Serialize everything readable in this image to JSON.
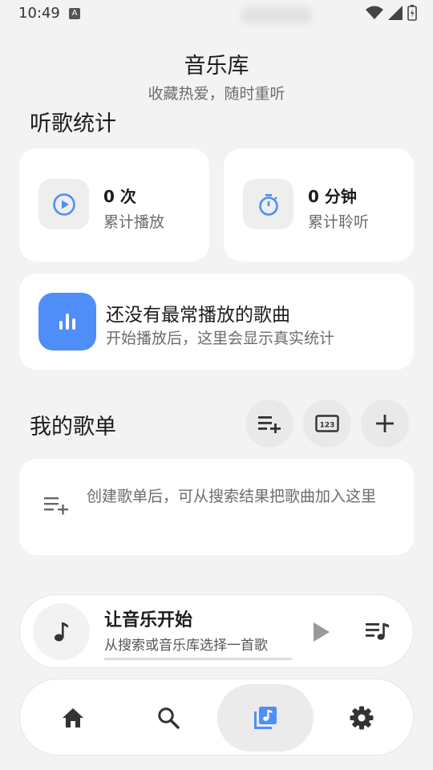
{
  "status": {
    "time": "10:49",
    "badge": "A"
  },
  "header": {
    "title": "音乐库",
    "subtitle": "收藏热爱，随时重听"
  },
  "stats": {
    "section_title": "听歌统计",
    "plays": {
      "value": "0 次",
      "label": "累计播放"
    },
    "duration": {
      "value": "0 分钟",
      "label": "累计聆听"
    }
  },
  "top_song": {
    "title": "还没有最常播放的歌曲",
    "subtitle": "开始播放后，这里会显示真实统计"
  },
  "playlists": {
    "section_title": "我的歌单",
    "empty_text": "创建歌单后，可从搜索结果把歌曲加入这里",
    "action_icons": [
      "playlist-add-icon",
      "numbers-icon",
      "plus-icon"
    ]
  },
  "player": {
    "title": "让音乐开始",
    "subtitle": "从搜索或音乐库选择一首歌",
    "progress": 0
  },
  "nav": {
    "items": [
      "home-icon",
      "search-icon",
      "library-music-icon",
      "settings-icon"
    ],
    "active_index": 2
  },
  "colors": {
    "accent": "#4f8ef7",
    "background": "#f3f3f3",
    "card": "#ffffff",
    "icon": "#333333"
  }
}
